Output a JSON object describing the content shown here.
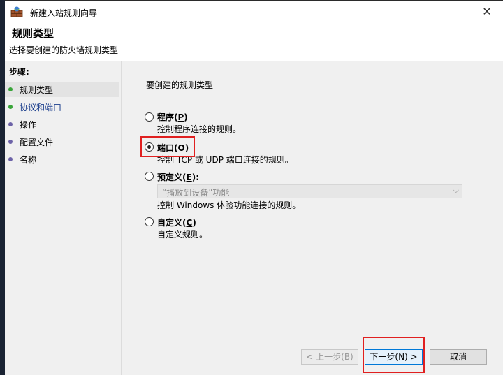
{
  "window": {
    "title": "新建入站规则向导",
    "close_glyph": "✕"
  },
  "header": {
    "title": "规则类型",
    "subtitle": "选择要创建的防火墙规则类型"
  },
  "steps": {
    "title": "步骤:",
    "items": [
      {
        "label": "规则类型"
      },
      {
        "label": "协议和端口"
      },
      {
        "label": "操作"
      },
      {
        "label": "配置文件"
      },
      {
        "label": "名称"
      }
    ]
  },
  "main": {
    "prompt": "要创建的规则类型",
    "options": [
      {
        "label": "程序(",
        "key": "P",
        "suffix": ")",
        "desc": "控制程序连接的规则。",
        "selected": false
      },
      {
        "label": "端口(",
        "key": "O",
        "suffix": ")",
        "desc": "控制 TCP 或 UDP 端口连接的规则。",
        "selected": true
      },
      {
        "label": "预定义(",
        "key": "E",
        "suffix": "):",
        "desc": "控制 Windows 体验功能连接的规则。",
        "selected": false
      },
      {
        "label": "自定义(",
        "key": "C",
        "suffix": ")",
        "desc": "自定义规则。",
        "selected": false
      }
    ],
    "predefined_select": {
      "value": "“播放到设备”功能"
    }
  },
  "buttons": {
    "back": "< 上一步(B)",
    "next": "下一步(N) >",
    "cancel": "取消"
  },
  "colors": {
    "highlight": "#e02020",
    "accent": "#0078d7"
  }
}
